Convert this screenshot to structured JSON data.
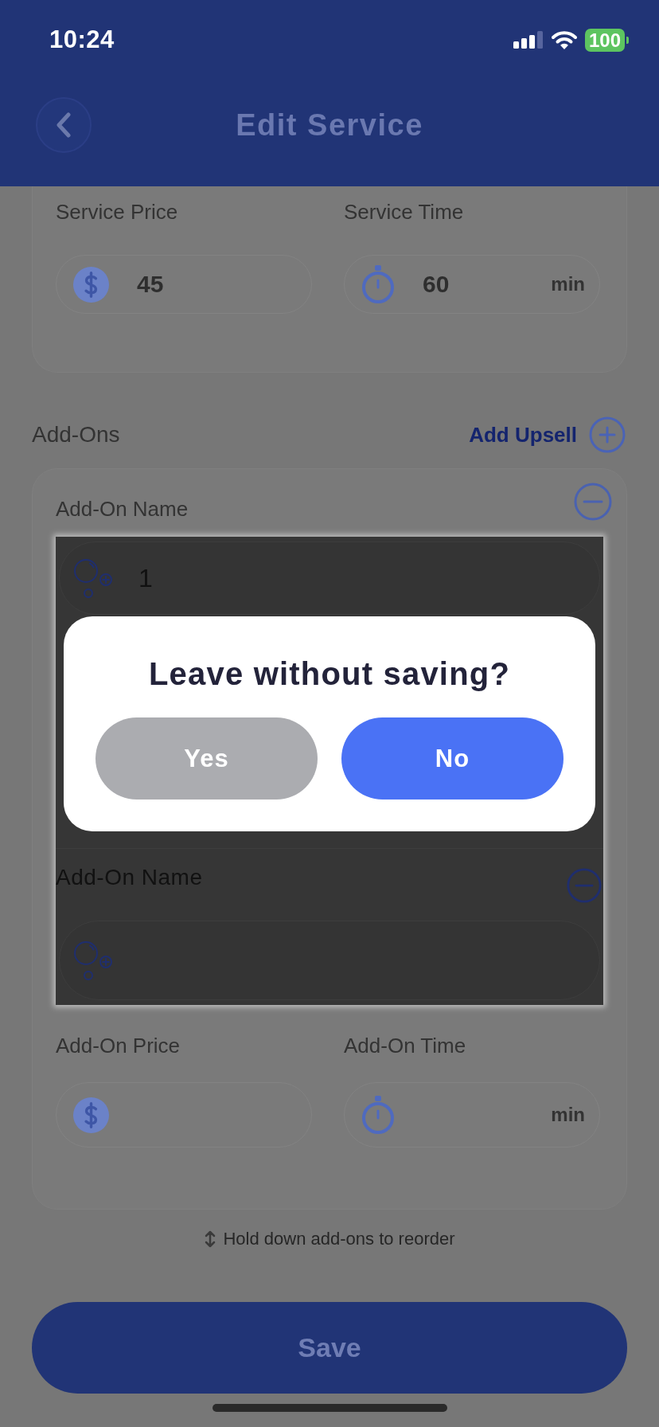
{
  "status_bar": {
    "time": "10:24",
    "battery": "100"
  },
  "header": {
    "title": "Edit Service"
  },
  "service": {
    "price": {
      "label": "Service Price",
      "value": "45"
    },
    "time": {
      "label": "Service Time",
      "value": "60",
      "unit": "min"
    }
  },
  "add_ons": {
    "title": "Add-Ons",
    "add_button": "Add Upsell",
    "items": [
      {
        "name_label": "Add-On Name",
        "name_value": "1"
      },
      {
        "name_label": "Add-On Name",
        "price_label": "Add-On Price",
        "time_label": "Add-On Time",
        "time_unit": "min"
      }
    ],
    "hint": "Hold down add-ons to reorder"
  },
  "save_button": "Save",
  "dialog": {
    "title": "Leave without saving?",
    "buttons": [
      {
        "label": "Yes",
        "kind": "secondary"
      },
      {
        "label": "No",
        "kind": "primary"
      }
    ]
  }
}
